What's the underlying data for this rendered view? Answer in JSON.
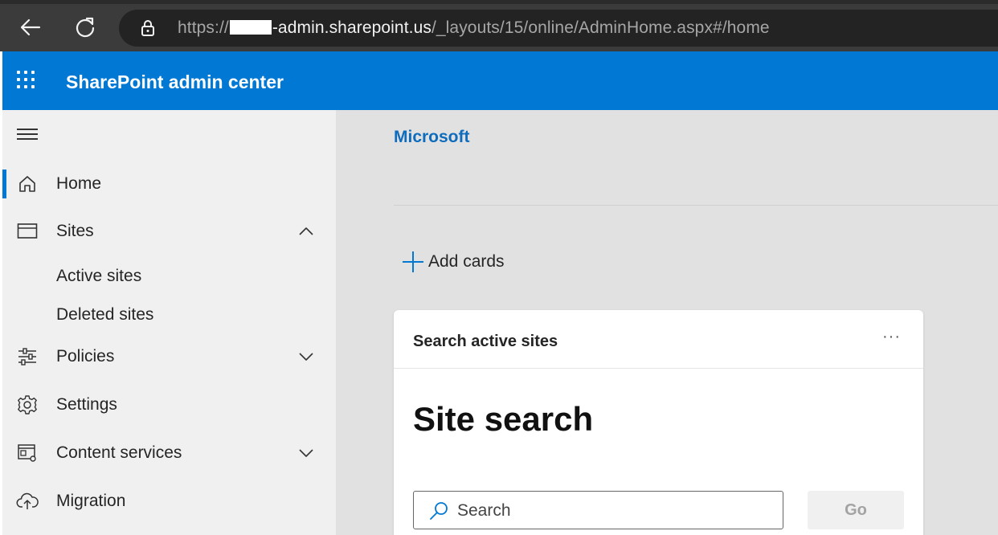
{
  "browser": {
    "url_prefix": "https://",
    "url_host": "-admin.sharepoint.us",
    "url_path": "/_layouts/15/online/AdminHome.aspx#/home"
  },
  "header": {
    "app_title": "SharePoint admin center",
    "accent_color": "#0078d4"
  },
  "sidebar": {
    "items": [
      {
        "label": "Home",
        "icon": "home-icon",
        "active": true
      },
      {
        "label": "Sites",
        "icon": "browser-window-icon",
        "expanded": true
      },
      {
        "label": "Active sites"
      },
      {
        "label": "Deleted sites"
      },
      {
        "label": "Policies",
        "icon": "sliders-icon",
        "expanded": false
      },
      {
        "label": "Settings",
        "icon": "gear-icon"
      },
      {
        "label": "Content services",
        "icon": "content-services-icon",
        "expanded": false
      },
      {
        "label": "Migration",
        "icon": "cloud-upload-icon"
      }
    ]
  },
  "main": {
    "brand": "Microsoft",
    "add_cards_label": "Add cards",
    "card": {
      "title": "Search active sites",
      "more_label": "···",
      "heading": "Site search",
      "search_placeholder": "Search",
      "go_label": "Go"
    }
  }
}
